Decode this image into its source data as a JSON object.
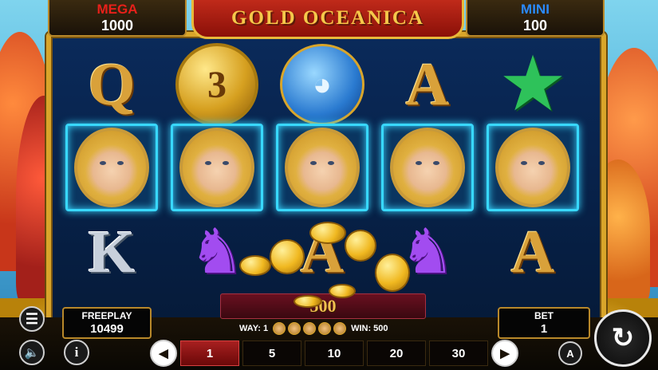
{
  "jackpots": {
    "mega": {
      "label": "MEGA",
      "value": "1000"
    },
    "mini": {
      "label": "MINI",
      "value": "100"
    }
  },
  "logo": {
    "title": "GOLD OCEANICA"
  },
  "reels": [
    {
      "top": "Q",
      "middle": "goddess",
      "bottom": "K"
    },
    {
      "top": "3",
      "middle": "goddess",
      "bottom": "seahorse"
    },
    {
      "top": "dolphin",
      "middle": "goddess",
      "bottom": "A"
    },
    {
      "top": "A",
      "middle": "goddess",
      "bottom": "seahorse"
    },
    {
      "top": "starfish",
      "middle": "goddess",
      "bottom": "A"
    }
  ],
  "win_amount": "500",
  "freeplay": {
    "label": "FREEPLAY",
    "value": "10499"
  },
  "bet": {
    "label": "BET",
    "value": "1"
  },
  "way_line": {
    "way_label": "WAY: 1",
    "win_label": "WIN: 500"
  },
  "bet_options": [
    "1",
    "5",
    "10",
    "20",
    "30"
  ],
  "selected_bet": "1",
  "controls": {
    "prev": "◀",
    "next": "▶",
    "menu": "☰",
    "sound": "🔈",
    "info": "i",
    "auto": "A",
    "spin": "↻"
  },
  "colors": {
    "frame_gold": "#d9a52a",
    "highlight_cyan": "#38d8ff",
    "active_bet_red": "#a82020"
  }
}
